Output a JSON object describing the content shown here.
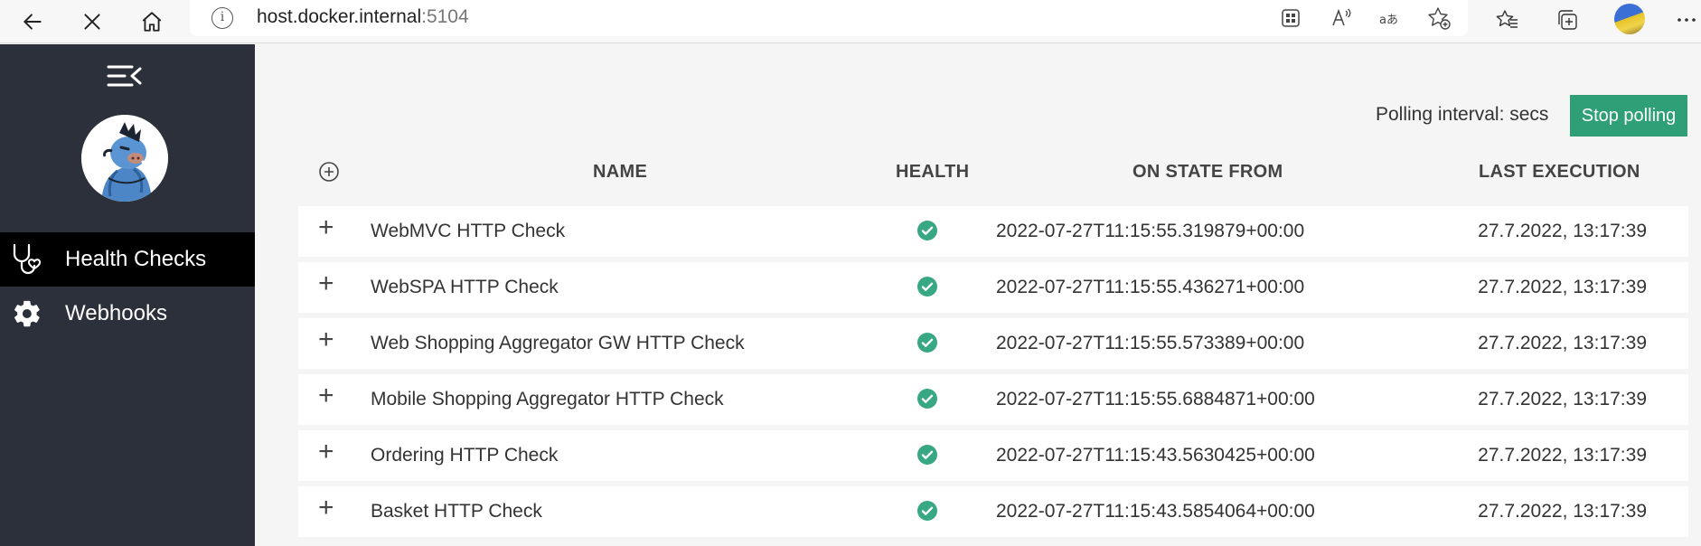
{
  "browser": {
    "url_host": "host.docker.internal",
    "url_port": ":5104"
  },
  "sidebar": {
    "items": [
      {
        "label": "Health Checks",
        "icon": "stethoscope-icon",
        "active": true
      },
      {
        "label": "Webhooks",
        "icon": "gear-icon",
        "active": false
      }
    ]
  },
  "toolbar": {
    "polling_label": "Polling interval: secs",
    "stop_label": "Stop polling"
  },
  "table": {
    "headers": {
      "name": "NAME",
      "health": "HEALTH",
      "on_state_from": "ON STATE FROM",
      "last_execution": "LAST EXECUTION"
    },
    "rows": [
      {
        "name": "WebMVC HTTP Check",
        "health": "healthy",
        "on_state_from": "2022-07-27T11:15:55.319879+00:00",
        "last_execution": "27.7.2022, 13:17:39"
      },
      {
        "name": "WebSPA HTTP Check",
        "health": "healthy",
        "on_state_from": "2022-07-27T11:15:55.436271+00:00",
        "last_execution": "27.7.2022, 13:17:39"
      },
      {
        "name": "Web Shopping Aggregator GW HTTP Check",
        "health": "healthy",
        "on_state_from": "2022-07-27T11:15:55.573389+00:00",
        "last_execution": "27.7.2022, 13:17:39"
      },
      {
        "name": "Mobile Shopping Aggregator HTTP Check",
        "health": "healthy",
        "on_state_from": "2022-07-27T11:15:55.6884871+00:00",
        "last_execution": "27.7.2022, 13:17:39"
      },
      {
        "name": "Ordering HTTP Check",
        "health": "healthy",
        "on_state_from": "2022-07-27T11:15:43.5630425+00:00",
        "last_execution": "27.7.2022, 13:17:39"
      },
      {
        "name": "Basket HTTP Check",
        "health": "healthy",
        "on_state_from": "2022-07-27T11:15:43.5854064+00:00",
        "last_execution": "27.7.2022, 13:17:39"
      }
    ]
  },
  "colors": {
    "sidebar_bg": "#2c303a",
    "active_item_bg": "#000000",
    "accent_green": "#2e9f76",
    "healthy_icon": "#38a884"
  }
}
